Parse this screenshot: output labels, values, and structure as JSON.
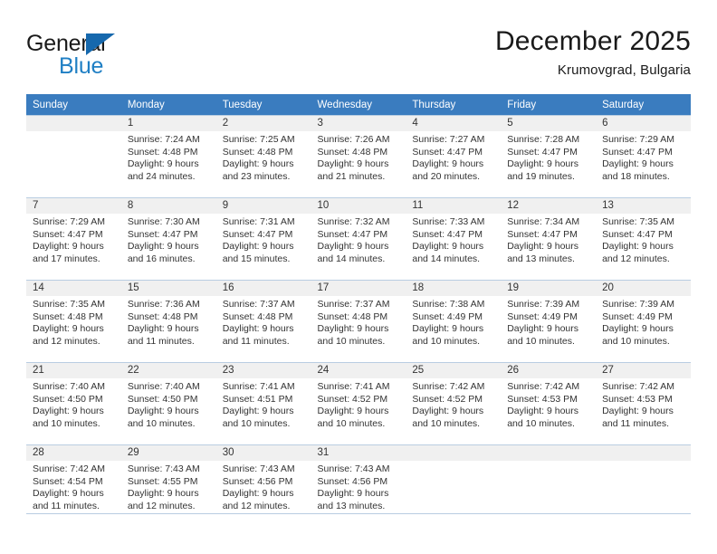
{
  "brand": {
    "name_top": "General",
    "name_bottom": "Blue",
    "triangle_icon": "triangle-logo-icon",
    "color_blue": "#1f7fc4",
    "color_triangle": "#1668ad"
  },
  "header": {
    "month_title": "December 2025",
    "location": "Krumovgrad, Bulgaria"
  },
  "colors": {
    "header_row_bg": "#3a7cbf",
    "header_row_text": "#ffffff",
    "daynum_bg": "#f0f0f0",
    "grid_line": "#b9cde2",
    "body_text": "#333333"
  },
  "weekday_headers": [
    "Sunday",
    "Monday",
    "Tuesday",
    "Wednesday",
    "Thursday",
    "Friday",
    "Saturday"
  ],
  "weeks": [
    [
      {
        "day": "",
        "sunrise": "",
        "sunset": "",
        "daylight_line1": "",
        "daylight_line2": ""
      },
      {
        "day": "1",
        "sunrise": "Sunrise: 7:24 AM",
        "sunset": "Sunset: 4:48 PM",
        "daylight_line1": "Daylight: 9 hours",
        "daylight_line2": "and 24 minutes."
      },
      {
        "day": "2",
        "sunrise": "Sunrise: 7:25 AM",
        "sunset": "Sunset: 4:48 PM",
        "daylight_line1": "Daylight: 9 hours",
        "daylight_line2": "and 23 minutes."
      },
      {
        "day": "3",
        "sunrise": "Sunrise: 7:26 AM",
        "sunset": "Sunset: 4:48 PM",
        "daylight_line1": "Daylight: 9 hours",
        "daylight_line2": "and 21 minutes."
      },
      {
        "day": "4",
        "sunrise": "Sunrise: 7:27 AM",
        "sunset": "Sunset: 4:47 PM",
        "daylight_line1": "Daylight: 9 hours",
        "daylight_line2": "and 20 minutes."
      },
      {
        "day": "5",
        "sunrise": "Sunrise: 7:28 AM",
        "sunset": "Sunset: 4:47 PM",
        "daylight_line1": "Daylight: 9 hours",
        "daylight_line2": "and 19 minutes."
      },
      {
        "day": "6",
        "sunrise": "Sunrise: 7:29 AM",
        "sunset": "Sunset: 4:47 PM",
        "daylight_line1": "Daylight: 9 hours",
        "daylight_line2": "and 18 minutes."
      }
    ],
    [
      {
        "day": "7",
        "sunrise": "Sunrise: 7:29 AM",
        "sunset": "Sunset: 4:47 PM",
        "daylight_line1": "Daylight: 9 hours",
        "daylight_line2": "and 17 minutes."
      },
      {
        "day": "8",
        "sunrise": "Sunrise: 7:30 AM",
        "sunset": "Sunset: 4:47 PM",
        "daylight_line1": "Daylight: 9 hours",
        "daylight_line2": "and 16 minutes."
      },
      {
        "day": "9",
        "sunrise": "Sunrise: 7:31 AM",
        "sunset": "Sunset: 4:47 PM",
        "daylight_line1": "Daylight: 9 hours",
        "daylight_line2": "and 15 minutes."
      },
      {
        "day": "10",
        "sunrise": "Sunrise: 7:32 AM",
        "sunset": "Sunset: 4:47 PM",
        "daylight_line1": "Daylight: 9 hours",
        "daylight_line2": "and 14 minutes."
      },
      {
        "day": "11",
        "sunrise": "Sunrise: 7:33 AM",
        "sunset": "Sunset: 4:47 PM",
        "daylight_line1": "Daylight: 9 hours",
        "daylight_line2": "and 14 minutes."
      },
      {
        "day": "12",
        "sunrise": "Sunrise: 7:34 AM",
        "sunset": "Sunset: 4:47 PM",
        "daylight_line1": "Daylight: 9 hours",
        "daylight_line2": "and 13 minutes."
      },
      {
        "day": "13",
        "sunrise": "Sunrise: 7:35 AM",
        "sunset": "Sunset: 4:47 PM",
        "daylight_line1": "Daylight: 9 hours",
        "daylight_line2": "and 12 minutes."
      }
    ],
    [
      {
        "day": "14",
        "sunrise": "Sunrise: 7:35 AM",
        "sunset": "Sunset: 4:48 PM",
        "daylight_line1": "Daylight: 9 hours",
        "daylight_line2": "and 12 minutes."
      },
      {
        "day": "15",
        "sunrise": "Sunrise: 7:36 AM",
        "sunset": "Sunset: 4:48 PM",
        "daylight_line1": "Daylight: 9 hours",
        "daylight_line2": "and 11 minutes."
      },
      {
        "day": "16",
        "sunrise": "Sunrise: 7:37 AM",
        "sunset": "Sunset: 4:48 PM",
        "daylight_line1": "Daylight: 9 hours",
        "daylight_line2": "and 11 minutes."
      },
      {
        "day": "17",
        "sunrise": "Sunrise: 7:37 AM",
        "sunset": "Sunset: 4:48 PM",
        "daylight_line1": "Daylight: 9 hours",
        "daylight_line2": "and 10 minutes."
      },
      {
        "day": "18",
        "sunrise": "Sunrise: 7:38 AM",
        "sunset": "Sunset: 4:49 PM",
        "daylight_line1": "Daylight: 9 hours",
        "daylight_line2": "and 10 minutes."
      },
      {
        "day": "19",
        "sunrise": "Sunrise: 7:39 AM",
        "sunset": "Sunset: 4:49 PM",
        "daylight_line1": "Daylight: 9 hours",
        "daylight_line2": "and 10 minutes."
      },
      {
        "day": "20",
        "sunrise": "Sunrise: 7:39 AM",
        "sunset": "Sunset: 4:49 PM",
        "daylight_line1": "Daylight: 9 hours",
        "daylight_line2": "and 10 minutes."
      }
    ],
    [
      {
        "day": "21",
        "sunrise": "Sunrise: 7:40 AM",
        "sunset": "Sunset: 4:50 PM",
        "daylight_line1": "Daylight: 9 hours",
        "daylight_line2": "and 10 minutes."
      },
      {
        "day": "22",
        "sunrise": "Sunrise: 7:40 AM",
        "sunset": "Sunset: 4:50 PM",
        "daylight_line1": "Daylight: 9 hours",
        "daylight_line2": "and 10 minutes."
      },
      {
        "day": "23",
        "sunrise": "Sunrise: 7:41 AM",
        "sunset": "Sunset: 4:51 PM",
        "daylight_line1": "Daylight: 9 hours",
        "daylight_line2": "and 10 minutes."
      },
      {
        "day": "24",
        "sunrise": "Sunrise: 7:41 AM",
        "sunset": "Sunset: 4:52 PM",
        "daylight_line1": "Daylight: 9 hours",
        "daylight_line2": "and 10 minutes."
      },
      {
        "day": "25",
        "sunrise": "Sunrise: 7:42 AM",
        "sunset": "Sunset: 4:52 PM",
        "daylight_line1": "Daylight: 9 hours",
        "daylight_line2": "and 10 minutes."
      },
      {
        "day": "26",
        "sunrise": "Sunrise: 7:42 AM",
        "sunset": "Sunset: 4:53 PM",
        "daylight_line1": "Daylight: 9 hours",
        "daylight_line2": "and 10 minutes."
      },
      {
        "day": "27",
        "sunrise": "Sunrise: 7:42 AM",
        "sunset": "Sunset: 4:53 PM",
        "daylight_line1": "Daylight: 9 hours",
        "daylight_line2": "and 11 minutes."
      }
    ],
    [
      {
        "day": "28",
        "sunrise": "Sunrise: 7:42 AM",
        "sunset": "Sunset: 4:54 PM",
        "daylight_line1": "Daylight: 9 hours",
        "daylight_line2": "and 11 minutes."
      },
      {
        "day": "29",
        "sunrise": "Sunrise: 7:43 AM",
        "sunset": "Sunset: 4:55 PM",
        "daylight_line1": "Daylight: 9 hours",
        "daylight_line2": "and 12 minutes."
      },
      {
        "day": "30",
        "sunrise": "Sunrise: 7:43 AM",
        "sunset": "Sunset: 4:56 PM",
        "daylight_line1": "Daylight: 9 hours",
        "daylight_line2": "and 12 minutes."
      },
      {
        "day": "31",
        "sunrise": "Sunrise: 7:43 AM",
        "sunset": "Sunset: 4:56 PM",
        "daylight_line1": "Daylight: 9 hours",
        "daylight_line2": "and 13 minutes."
      },
      {
        "day": "",
        "sunrise": "",
        "sunset": "",
        "daylight_line1": "",
        "daylight_line2": ""
      },
      {
        "day": "",
        "sunrise": "",
        "sunset": "",
        "daylight_line1": "",
        "daylight_line2": ""
      },
      {
        "day": "",
        "sunrise": "",
        "sunset": "",
        "daylight_line1": "",
        "daylight_line2": ""
      }
    ]
  ]
}
